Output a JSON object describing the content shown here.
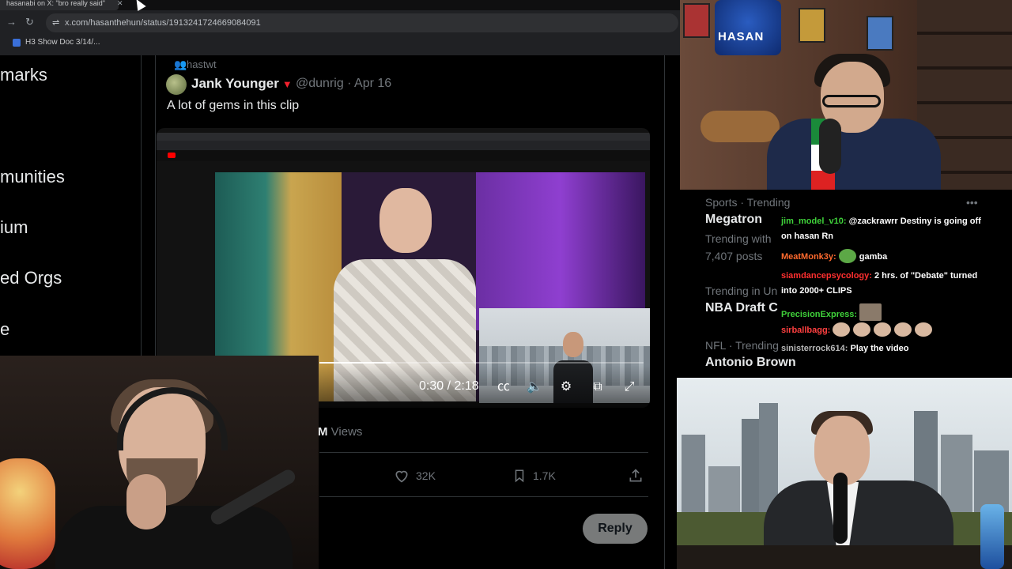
{
  "browser": {
    "tab_title": "hasanabi on X: \"bro really said\"",
    "url": "x.com/hasanthehun/status/1913241724669084091",
    "bookmark": "H3 Show Doc 3/14/..."
  },
  "sidebar": {
    "items": [
      {
        "label": "marks"
      },
      {
        "label": "munities"
      },
      {
        "label": "ium"
      },
      {
        "label": "ed Orgs"
      },
      {
        "label": "e"
      }
    ]
  },
  "post": {
    "repost_by": "hastwt",
    "author_name": "Jank Younger",
    "handle_date": "@dunrig · Apr 16",
    "text": "A lot of gems in this clip",
    "video": {
      "time": "0:30 / 2:18",
      "progress_fraction": 0.22
    },
    "views_count": "M",
    "views_label": "Views",
    "likes": "32K",
    "bookmarks": "1.7K",
    "reply_label": "Reply"
  },
  "webcam": {
    "channel_logo": "HASAN"
  },
  "trending": [
    {
      "sub": "Sports · Trending",
      "topic": "Megatron"
    },
    {
      "sub": "Trending with",
      "topic": ""
    },
    {
      "sub": "7,407 posts",
      "topic": ""
    },
    {
      "sub": "Trending in Un",
      "topic": "NBA Draft C"
    },
    {
      "sub": "NFL · Trending",
      "topic": "Antonio Brown"
    }
  ],
  "chat": [
    {
      "user": "jim_model_v10:",
      "color": "#3fd13a",
      "text": " @zackrawrr Destiny is going off on hasan Rn"
    },
    {
      "user": "MeatMonk3y:",
      "color": "#ff6a2e",
      "text": "gamba",
      "emote": "pepe-emote"
    },
    {
      "user": "siamdancepsycology:",
      "color": "#ff2f2f",
      "text": " 2 hrs. of \"Debate\" turned into 2000+ CLIPS"
    },
    {
      "user": "PrecisionExpress:",
      "color": "#3fd13a",
      "text": "",
      "emote": "image-emote"
    },
    {
      "user": "sirballbagg:",
      "color": "#ff4040",
      "text": "",
      "emote": "face-emotes"
    },
    {
      "user": "sinisterrock614:",
      "color": "#b8b8b8",
      "text": " Play the video"
    }
  ]
}
